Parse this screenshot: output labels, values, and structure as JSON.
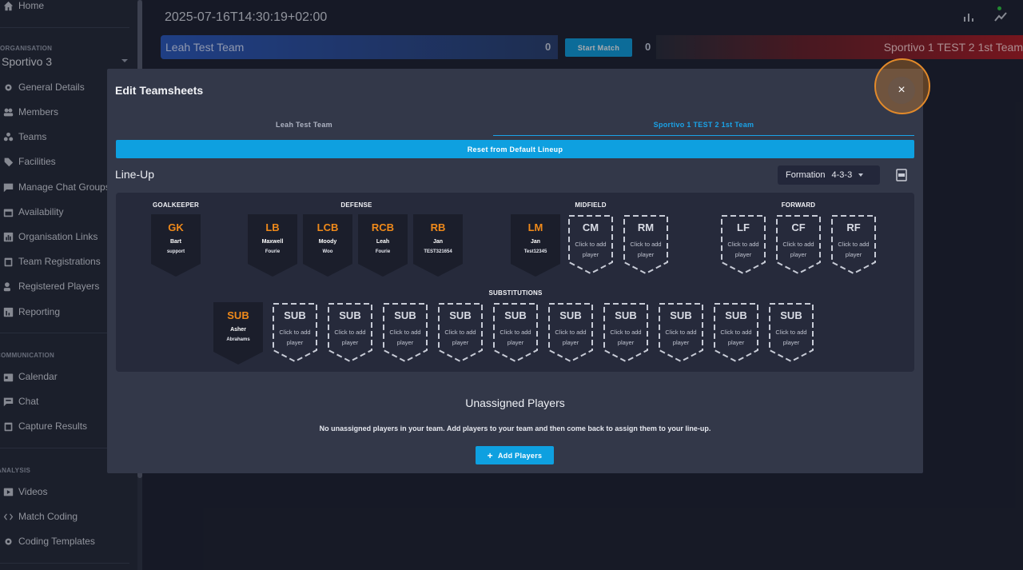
{
  "sidebar": {
    "home": "Home",
    "org_section": "ORGANISATION",
    "org_name": "Sportivo 3",
    "org_items": [
      "General Details",
      "Members",
      "Teams",
      "Facilities",
      "Manage Chat Groups",
      "Availability",
      "Organisation Links",
      "Team Registrations",
      "Registered Players",
      "Reporting"
    ],
    "comm_section": "COMMUNICATION",
    "comm_items": [
      "Calendar",
      "Chat",
      "Capture Results"
    ],
    "analysis_section": "ANALYSIS",
    "analysis_items": [
      "Videos",
      "Match Coding",
      "Coding Templates"
    ]
  },
  "header": {
    "datetime": "2025-07-16T14:30:19+02:00",
    "icons": [
      "bar-chart-icon",
      "trend-line-icon"
    ]
  },
  "scorebar": {
    "home_team": "Leah Test Team",
    "home_score": "0",
    "start_label": "Start Match",
    "away_score": "0",
    "away_team": "Sportivo 1 TEST 2 1st Team"
  },
  "modal": {
    "title": "Edit Teamsheets",
    "close_label": "×",
    "tabs": [
      {
        "label": "Leah Test Team",
        "active": false
      },
      {
        "label": "Sportivo 1 TEST 2 1st Team",
        "active": true
      }
    ],
    "reset_label": "Reset from Default Lineup",
    "lineup_title": "Line-Up",
    "formation_label": "Formation",
    "formation_value": "4-3-3",
    "groups": {
      "goalkeeper": "GOALKEEPER",
      "defense": "DEFENSE",
      "midfield": "MIDFIELD",
      "forward": "FORWARD",
      "substitutions": "SUBSTITUTIONS"
    },
    "empty_hint": "Click to add player",
    "positions": [
      {
        "pos": "GK",
        "first": "Bart",
        "last": "support"
      },
      {
        "pos": "LB",
        "first": "Maxwell",
        "last": "Fourie"
      },
      {
        "pos": "LCB",
        "first": "Moody",
        "last": "Woo"
      },
      {
        "pos": "RCB",
        "first": "Leah",
        "last": "Fourie"
      },
      {
        "pos": "RB",
        "first": "Jan",
        "last": "TEST321654"
      },
      {
        "pos": "LM",
        "first": "Jan",
        "last": "Test12345"
      },
      {
        "pos": "CM",
        "first": "",
        "last": ""
      },
      {
        "pos": "RM",
        "first": "",
        "last": ""
      },
      {
        "pos": "LF",
        "first": "",
        "last": ""
      },
      {
        "pos": "CF",
        "first": "",
        "last": ""
      },
      {
        "pos": "RF",
        "first": "",
        "last": ""
      }
    ],
    "subs": [
      {
        "pos": "SUB",
        "first": "Asher",
        "last": "Abrahams"
      },
      {
        "pos": "SUB",
        "first": "",
        "last": ""
      },
      {
        "pos": "SUB",
        "first": "",
        "last": ""
      },
      {
        "pos": "SUB",
        "first": "",
        "last": ""
      },
      {
        "pos": "SUB",
        "first": "",
        "last": ""
      },
      {
        "pos": "SUB",
        "first": "",
        "last": ""
      },
      {
        "pos": "SUB",
        "first": "",
        "last": ""
      },
      {
        "pos": "SUB",
        "first": "",
        "last": ""
      },
      {
        "pos": "SUB",
        "first": "",
        "last": ""
      },
      {
        "pos": "SUB",
        "first": "",
        "last": ""
      },
      {
        "pos": "SUB",
        "first": "",
        "last": ""
      }
    ],
    "unassigned_title": "Unassigned Players",
    "unassigned_msg": "No unassigned players in your team. Add players to your team and then come back to assign them to your line-up.",
    "add_label": "Add Players"
  },
  "colors": {
    "accent": "#0ea0e0",
    "position_orange": "#f08a1a",
    "home_blue": "#2c5ac0",
    "away_red": "#b01c24"
  }
}
